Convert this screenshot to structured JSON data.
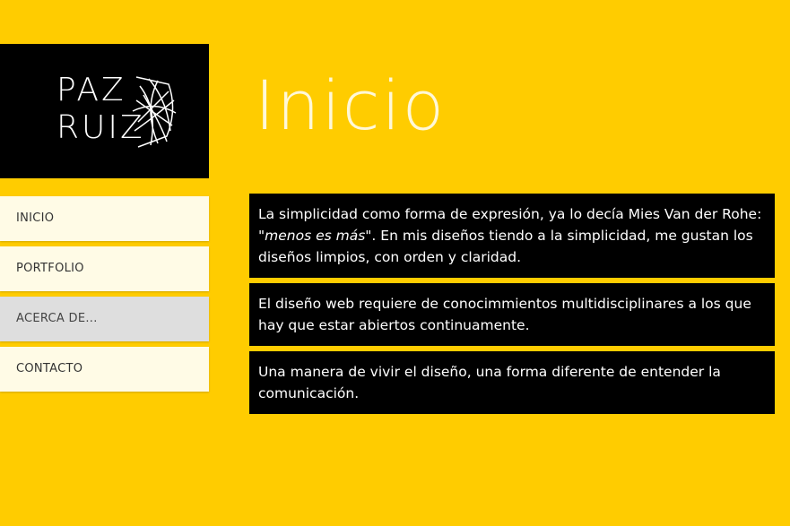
{
  "logo": {
    "line1": "PAZ",
    "line2": "RUIZ"
  },
  "nav": {
    "items": [
      {
        "label": "INICIO",
        "active": false
      },
      {
        "label": "PORTFOLIO",
        "active": false
      },
      {
        "label": "ACERCA DE...",
        "active": true
      },
      {
        "label": "CONTACTO",
        "active": false
      }
    ]
  },
  "main": {
    "title": "Inicio",
    "paragraphs": [
      {
        "before": "La simplicidad como forma de expresión, ya lo decía Mies Van der Rohe: ",
        "quote": "\"menos es más\"",
        "after": ". En mis diseños tiendo a la simplicidad, me gustan los diseños limpios, con orden y claridad."
      },
      {
        "text": "El diseño web requiere de conocimmientos multidisciplinares a los que hay que estar abiertos continuamente."
      },
      {
        "text": "Una manera de vivir el diseño, una forma diferente de entender la comunicación."
      }
    ]
  },
  "colors": {
    "background": "#ffcc00",
    "logo_bg": "#000000",
    "nav_bg": "#fffbe6",
    "nav_active_bg": "#dedede",
    "title_color": "#fff8d8",
    "paragraph_bg": "#000000",
    "paragraph_text": "#ffffff"
  }
}
